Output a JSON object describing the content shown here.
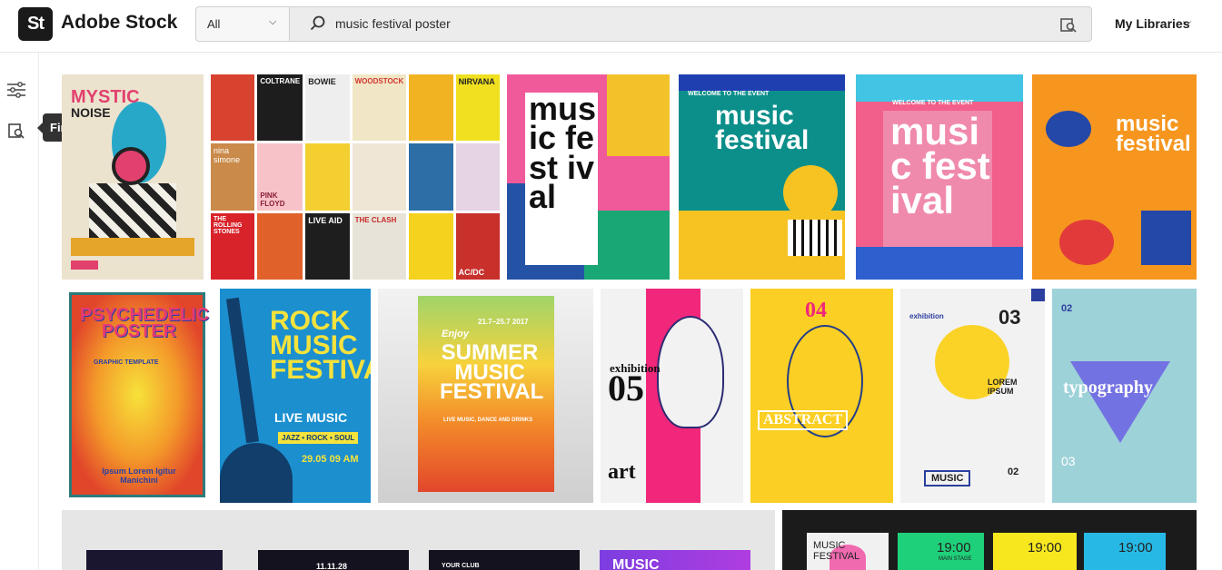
{
  "header": {
    "logo_mark": "St",
    "brand": "Adobe Stock",
    "scope": "All",
    "query": "music festival poster",
    "my_libraries": "My Libraries"
  },
  "rail": {
    "tooltip": "Find Similar"
  },
  "results": {
    "t1": {
      "title": "MYSTIC",
      "sub": "NOISE"
    },
    "t2": {
      "labels": [
        "COLTRANE",
        "BOWIE",
        "WOODSTOCK",
        "NIRVANA",
        "nina simone",
        "PINK FLOYD",
        "THE ROLLING STONES",
        "LIVE AID",
        "THE CLASH",
        "AC/DC"
      ]
    },
    "t3": {
      "title": "music fest ival"
    },
    "t4": {
      "top": "WELCOME TO THE EVENT",
      "title": "music festival"
    },
    "t5": {
      "top": "WELCOME TO THE EVENT",
      "title": "music fest ival"
    },
    "t6": {
      "title": "music festival"
    },
    "t7": {
      "title": "PSYCHEDELIC POSTER",
      "sub": "GRAPHIC TEMPLATE",
      "bottom": "Ipsum Lorem Igitur Manichini"
    },
    "t8": {
      "title": "ROCK MUSIC FESTIVAL",
      "live": "LIVE MUSIC",
      "genres": "JAZZ • ROCK • SOUL",
      "date": "29.05  09 AM"
    },
    "t9": {
      "enjoy": "Enjoy",
      "dates": "21.7–25.7 2017",
      "title": "SUMMER MUSIC FESTIVAL",
      "sub": "LIVE MUSIC, DANCE AND DRINKS"
    },
    "t10": {
      "title": "exhibition",
      "num": "05",
      "art": "art"
    },
    "t11": {
      "num": "04",
      "title": "ABSTRACT"
    },
    "t12": {
      "title": "exhibition",
      "num": "03",
      "lorem": "LOREM IPSUM",
      "music": "MUSIC",
      "small": "02"
    },
    "t13": {
      "top": "02",
      "title": "typography",
      "bottom": "03"
    },
    "t14": {
      "labels": [
        "11.11.28",
        "YOUR CLUB",
        "MUSIC"
      ]
    },
    "t15": {
      "title": "MUSIC FESTIVAL",
      "times": [
        "19:00",
        "19:00",
        "19:00"
      ],
      "stage": "MAIN STAGE"
    }
  }
}
